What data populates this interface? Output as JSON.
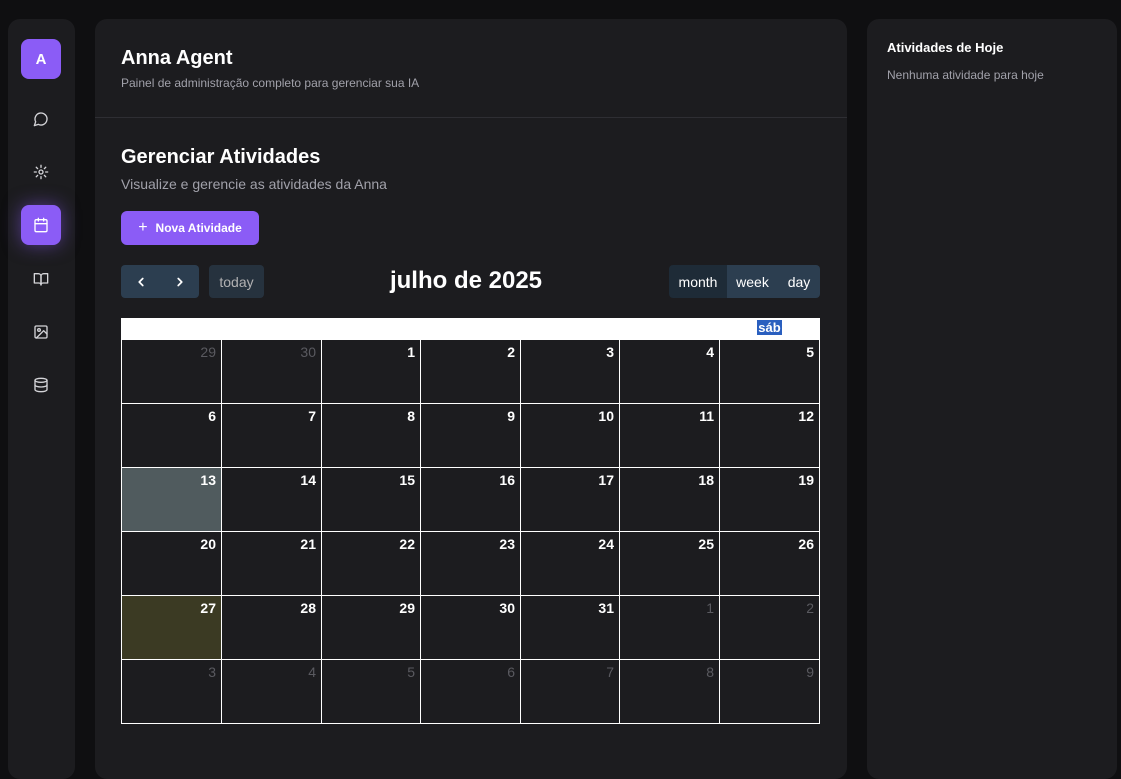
{
  "sidebar": {
    "avatar": "A",
    "items": [
      {
        "icon": "chat-icon"
      },
      {
        "icon": "gear-icon"
      },
      {
        "icon": "calendar-icon",
        "active": true
      },
      {
        "icon": "book-icon"
      },
      {
        "icon": "image-icon"
      },
      {
        "icon": "database-icon"
      }
    ]
  },
  "header": {
    "title": "Anna Agent",
    "subtitle": "Painel de administração completo para gerenciar sua IA"
  },
  "section": {
    "title": "Gerenciar Atividades",
    "subtitle": "Visualize e gerencie as atividades da Anna",
    "new_button": "Nova Atividade"
  },
  "calendar": {
    "today_label": "today",
    "title": "julho de 2025",
    "views": [
      "month",
      "week",
      "day"
    ],
    "weekday_headers": [
      "",
      "",
      "",
      "",
      "",
      "",
      "sáb"
    ],
    "weeks": [
      [
        "29",
        "30",
        "1",
        "2",
        "3",
        "4",
        "5"
      ],
      [
        "6",
        "7",
        "8",
        "9",
        "10",
        "11",
        "12"
      ],
      [
        "13",
        "14",
        "15",
        "16",
        "17",
        "18",
        "19"
      ],
      [
        "20",
        "21",
        "22",
        "23",
        "24",
        "25",
        "26"
      ],
      [
        "27",
        "28",
        "29",
        "30",
        "31",
        "1",
        "2"
      ],
      [
        "3",
        "4",
        "5",
        "6",
        "7",
        "8",
        "9"
      ]
    ]
  },
  "today_panel": {
    "title": "Atividades de Hoje",
    "empty": "Nenhuma atividade para hoje"
  },
  "colors": {
    "accent": "#8b5cf6",
    "background": "#0f0f11",
    "panel": "#1c1c1f",
    "button_dark": "#2c3e50",
    "today_cell": "#505b5e",
    "highlight_cell": "#3b3a23"
  }
}
